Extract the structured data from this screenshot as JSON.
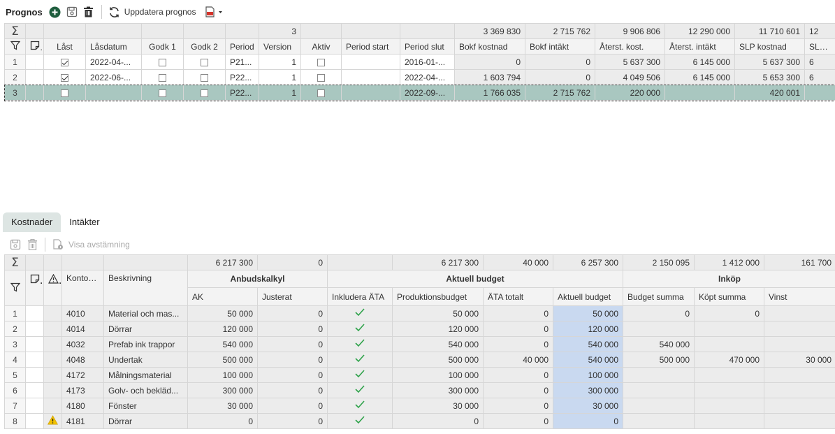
{
  "toolbar": {
    "title": "Prognos",
    "refresh_label": "Uppdatera prognos"
  },
  "top_grid": {
    "sum_row": [
      "",
      "",
      "",
      "",
      "",
      "",
      "",
      "3",
      "",
      "",
      "",
      "3 369 830",
      "2 715 762",
      "9 906 806",
      "12 290 000",
      "11 710 601",
      "12"
    ],
    "headers": [
      "Låst",
      "Låsdatum",
      "Godk 1",
      "Godk 2",
      "Period",
      "Version",
      "Aktiv",
      "Period start",
      "Period slut",
      "Bokf kostnad",
      "Bokf intäkt",
      "Återst. kost.",
      "Återst. intäkt",
      "SLP kostnad",
      "SLP int"
    ],
    "rows": [
      {
        "idx": "1",
        "last": true,
        "lasdatum": "2022-04-...",
        "godk1": false,
        "godk2": false,
        "period": "P21...",
        "version": "1",
        "aktiv": false,
        "pstart": "",
        "pslut": "2016-01-...",
        "bokf_k": "0",
        "bokf_i": "0",
        "aterst_k": "5 637 300",
        "aterst_i": "6 145 000",
        "slp_k": "5 637 300",
        "slp_i": "6"
      },
      {
        "idx": "2",
        "last": true,
        "lasdatum": "2022-06-...",
        "godk1": false,
        "godk2": false,
        "period": "P22...",
        "version": "1",
        "aktiv": false,
        "pstart": "",
        "pslut": "2022-04-...",
        "bokf_k": "1 603 794",
        "bokf_i": "0",
        "aterst_k": "4 049 506",
        "aterst_i": "6 145 000",
        "slp_k": "5 653 300",
        "slp_i": "6"
      },
      {
        "idx": "3",
        "last": false,
        "lasdatum": "",
        "godk1": false,
        "godk2": false,
        "period": "P22...",
        "version": "1",
        "aktiv": false,
        "pstart": "",
        "pslut": "2022-09-...",
        "bokf_k": "1 766 035",
        "bokf_i": "2 715 762",
        "aterst_k": "220 000",
        "aterst_i": "",
        "slp_k": "420 001",
        "slp_i": ""
      }
    ]
  },
  "tabs": [
    {
      "label": "Kostnader",
      "active": true
    },
    {
      "label": "Intäkter",
      "active": false
    }
  ],
  "toolbar2": {
    "reconcile_label": "Visa avstämning"
  },
  "bottom_grid": {
    "sum_row": [
      "6 217 300",
      "0",
      "",
      "6 217 300",
      "40 000",
      "6 257 300",
      "2 150 095",
      "1 412 000",
      "161 700"
    ],
    "groups": {
      "anbud": "Anbudskalkyl",
      "aktuell": "Aktuell budget",
      "inkop": "Inköp"
    },
    "headers": {
      "kontonr": "Kontonr",
      "beskrivning": "Beskrivning",
      "ak": "AK",
      "justerat": "Justerat",
      "inkl_ata": "Inkludera ÄTA",
      "prodbudget": "Produktionsbudget",
      "ata_totalt": "ÄTA totalt",
      "aktuell_budget": "Aktuell budget",
      "budget_summa": "Budget summa",
      "kopt_summa": "Köpt summa",
      "vinst": "Vinst"
    },
    "rows": [
      {
        "idx": "1",
        "warn": false,
        "kontonr": "4010",
        "beskr": "Material och mas...",
        "ak": "50 000",
        "just": "0",
        "prod": "50 000",
        "ata": "0",
        "akt": "50 000",
        "bsum": "0",
        "kopt": "0",
        "vinst": ""
      },
      {
        "idx": "2",
        "warn": false,
        "kontonr": "4014",
        "beskr": "Dörrar",
        "ak": "120 000",
        "just": "0",
        "prod": "120 000",
        "ata": "0",
        "akt": "120 000",
        "bsum": "",
        "kopt": "",
        "vinst": ""
      },
      {
        "idx": "3",
        "warn": false,
        "kontonr": "4032",
        "beskr": "Prefab ink trappor",
        "ak": "540 000",
        "just": "0",
        "prod": "540 000",
        "ata": "0",
        "akt": "540 000",
        "bsum": "540 000",
        "kopt": "",
        "vinst": ""
      },
      {
        "idx": "4",
        "warn": false,
        "kontonr": "4048",
        "beskr": "Undertak",
        "ak": "500 000",
        "just": "0",
        "prod": "500 000",
        "ata": "40 000",
        "akt": "540 000",
        "bsum": "500 000",
        "kopt": "470 000",
        "vinst": "30 000"
      },
      {
        "idx": "5",
        "warn": false,
        "kontonr": "4172",
        "beskr": "Målningsmaterial",
        "ak": "100 000",
        "just": "0",
        "prod": "100 000",
        "ata": "0",
        "akt": "100 000",
        "bsum": "",
        "kopt": "",
        "vinst": ""
      },
      {
        "idx": "6",
        "warn": false,
        "kontonr": "4173",
        "beskr": "Golv- och bekläd...",
        "ak": "300 000",
        "just": "0",
        "prod": "300 000",
        "ata": "0",
        "akt": "300 000",
        "bsum": "",
        "kopt": "",
        "vinst": ""
      },
      {
        "idx": "7",
        "warn": false,
        "kontonr": "4180",
        "beskr": "Fönster",
        "ak": "30 000",
        "just": "0",
        "prod": "30 000",
        "ata": "0",
        "akt": "30 000",
        "bsum": "",
        "kopt": "",
        "vinst": ""
      },
      {
        "idx": "8",
        "warn": true,
        "kontonr": "4181",
        "beskr": "Dörrar",
        "ak": "0",
        "just": "0",
        "prod": "0",
        "ata": "0",
        "akt": "0",
        "bsum": "",
        "kopt": "",
        "vinst": ""
      }
    ]
  },
  "colors": {
    "accent_green": "#2e7d4f",
    "selected_row": "#a9c7c0",
    "highlight_blue": "#c9d9f0",
    "warning": "#f2c200"
  }
}
